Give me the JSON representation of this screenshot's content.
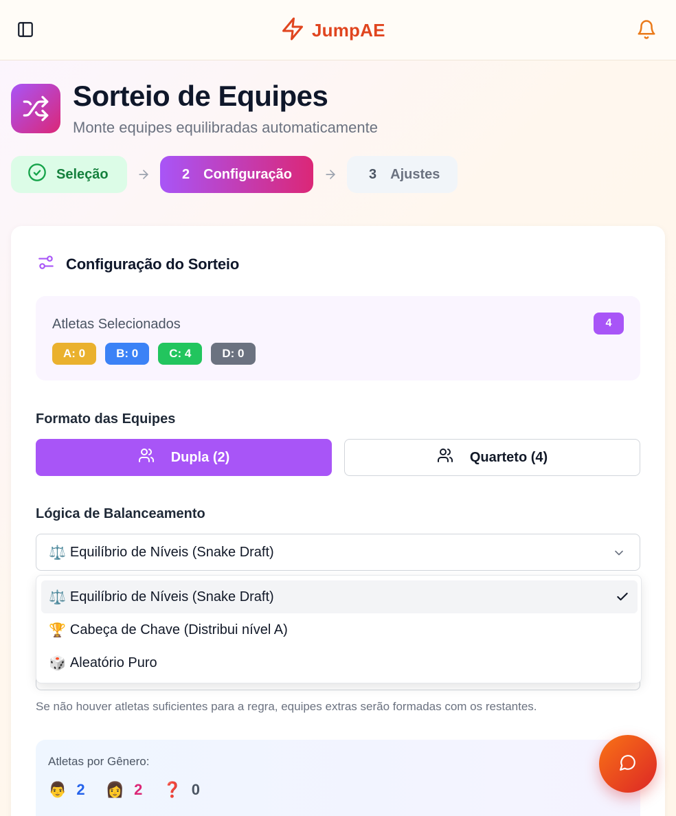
{
  "app": {
    "name": "JumpAE"
  },
  "header": {
    "title": "Sorteio de Equipes",
    "subtitle": "Monte equipes equilibradas automaticamente"
  },
  "stepper": {
    "steps": [
      {
        "number": "",
        "label": "Seleção",
        "state": "done"
      },
      {
        "number": "2",
        "label": "Configuração",
        "state": "active"
      },
      {
        "number": "3",
        "label": "Ajustes",
        "state": "todo"
      }
    ]
  },
  "config": {
    "title": "Configuração do Sorteio",
    "selected_label": "Atletas Selecionados",
    "selected_count": "4",
    "levels": [
      {
        "label": "A: 0",
        "color": "#eab12e"
      },
      {
        "label": "B: 0",
        "color": "#3b82f6"
      },
      {
        "label": "C: 4",
        "color": "#22c55e"
      },
      {
        "label": "D: 0",
        "color": "#6b7280"
      }
    ],
    "format_label": "Formato das Equipes",
    "format_options": [
      {
        "label": "Dupla (2)",
        "selected": true
      },
      {
        "label": "Quarteto (4)",
        "selected": false
      }
    ],
    "logic_label": "Lógica de Balanceamento",
    "logic_selected": "Equilíbrio de Níveis (Snake Draft)",
    "logic_selected_emoji": "⚖️",
    "logic_options": [
      {
        "emoji": "⚖️",
        "label": "Equilíbrio de Níveis (Snake Draft)",
        "selected": true
      },
      {
        "emoji": "🏆",
        "label": "Cabeça de Chave (Distribui nível A)",
        "selected": false
      },
      {
        "emoji": "🎲",
        "label": "Aleatório Puro",
        "selected": false
      }
    ],
    "helper": "Se não houver atletas suficientes para a regra, equipes extras serão formadas com os restantes.",
    "gender_label": "Atletas por Gênero:",
    "genders": [
      {
        "emoji": "👨",
        "count": "2",
        "color": "#2563eb"
      },
      {
        "emoji": "👩",
        "count": "2",
        "color": "#db2777"
      },
      {
        "emoji": "❓",
        "count": "0",
        "color": "#4b5563"
      }
    ]
  },
  "colors": {
    "brand": "#e0451f",
    "accent": "#a855f7",
    "pink": "#db2777",
    "success": "#15803d"
  }
}
